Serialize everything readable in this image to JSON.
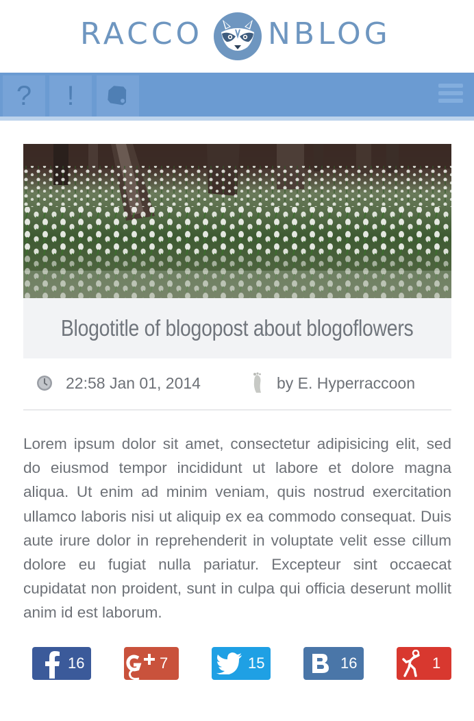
{
  "logo": {
    "left_text": "RACCO",
    "right_text": "NBLOG",
    "icon": "raccoon-face-icon"
  },
  "nav": {
    "buttons": [
      {
        "label": "?",
        "icon": "question-icon"
      },
      {
        "label": "!",
        "icon": "exclamation-icon"
      },
      {
        "label": "",
        "icon": "tag-icon"
      }
    ],
    "menu_icon": "hamburger-icon"
  },
  "post": {
    "title": "Blogotitle of blogopost about blogoflowers",
    "datetime": "22:58 Jan 01, 2014",
    "author": "by E. Hyperraccoon",
    "body": "Lorem ipsum dolor sit amet, consectetur adipisicing elit, sed do eiusmod tempor incididunt ut labore et dolore magna aliqua. Ut enim ad minim veniam, quis nostrud exercitation ullamco laboris nisi ut aliquip ex ea commodo consequat. Duis aute irure dolor in reprehenderit in voluptate velit esse cillum dolore eu fugiat nulla pariatur. Excepteur sint occaecat cupidatat non proident, sunt in culpa qui officia deserunt mollit anim id est laborum."
  },
  "social": {
    "facebook": {
      "count": "16",
      "color": "#3b5a9a"
    },
    "googleplus": {
      "count": "7",
      "color": "#c9523c"
    },
    "twitter": {
      "count": "15",
      "color": "#1fa0e4"
    },
    "vk": {
      "count": "16",
      "color": "#4a76a8"
    },
    "moimir": {
      "count": "1",
      "color": "#d8382f"
    }
  },
  "colors": {
    "accent": "#6b9bd2",
    "logo": "#6e96c0",
    "text": "#6d7177"
  }
}
